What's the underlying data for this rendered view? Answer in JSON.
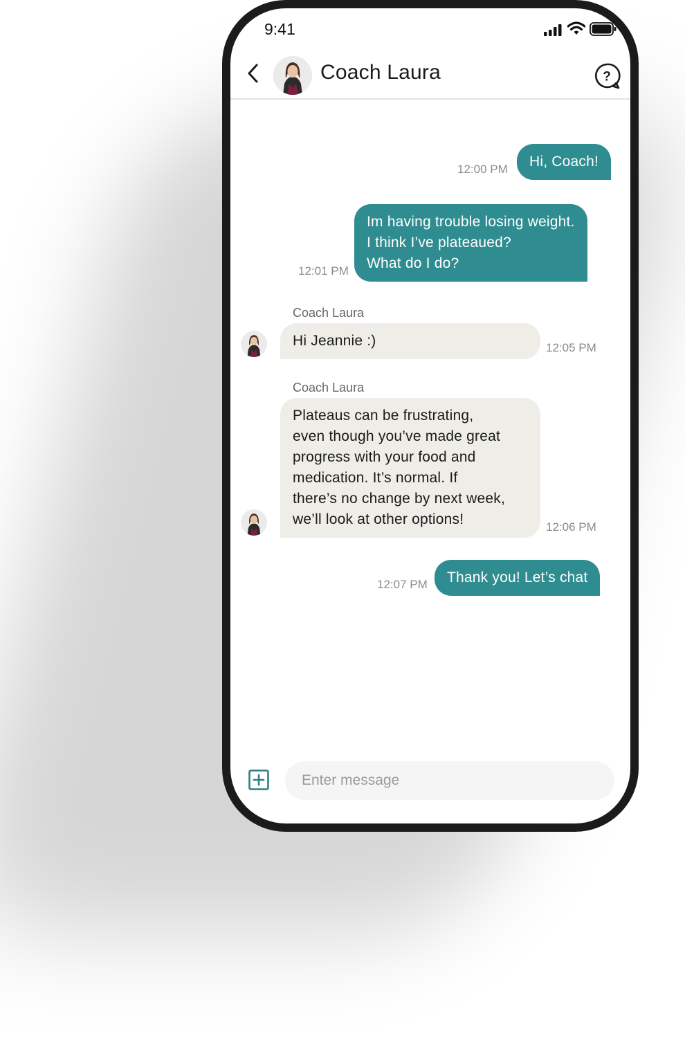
{
  "status_bar": {
    "time": "9:41",
    "icons": [
      "signal-icon",
      "wifi-icon",
      "battery-icon"
    ]
  },
  "header": {
    "title": "Coach Laura",
    "back_icon": "chevron-left-icon",
    "help_icon": "question-bubble-icon"
  },
  "colors": {
    "outgoing_bubble": "#2f8c90",
    "incoming_bubble": "#eeede8",
    "phone_frame": "#1b1b1b"
  },
  "messages": [
    {
      "direction": "out",
      "text": "Hi, Coach!",
      "time": "12:00 PM"
    },
    {
      "direction": "out",
      "text": "Im having trouble losing weight.\nI think I’ve plateaued?\nWhat do I do?",
      "time": "12:01 PM"
    },
    {
      "direction": "in",
      "sender": "Coach Laura",
      "text": "Hi Jeannie :)",
      "time": "12:05 PM"
    },
    {
      "direction": "in",
      "sender": "Coach Laura",
      "text": "Plateaus can be frustrating,\neven though you’ve made great\nprogress with your food and\nmedication. It’s normal. If\nthere’s no change by next week,\nwe’ll look at other options!",
      "time": "12:06 PM"
    },
    {
      "direction": "out",
      "text": "Thank you! Let’s chat",
      "time": "12:07 PM"
    }
  ],
  "composer": {
    "placeholder": "Enter message",
    "value": "",
    "attach_icon": "plus-square-icon"
  }
}
